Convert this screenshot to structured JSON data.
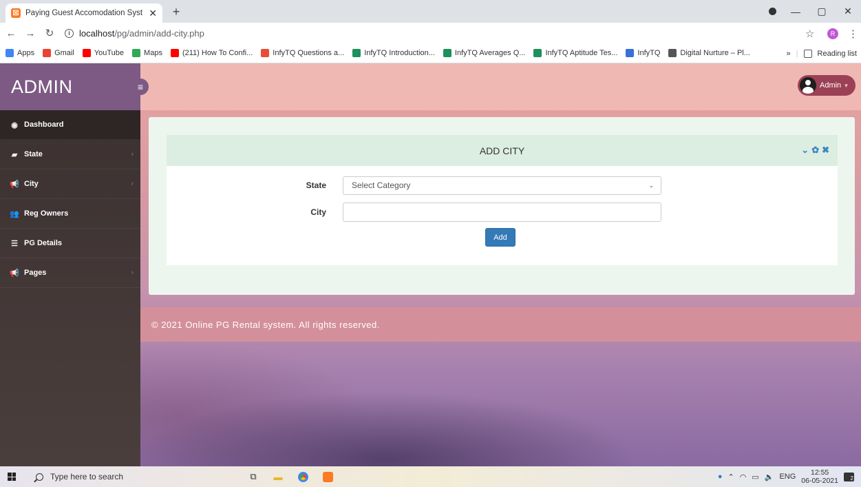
{
  "browser": {
    "tab_title": "Paying Guest Accomodation Syst",
    "url_host": "localhost",
    "url_path": "/pg/admin/add-city.php",
    "profile_initial": "R",
    "bookmarks": [
      {
        "label": "Apps",
        "color": "#4285f4"
      },
      {
        "label": "Gmail",
        "color": "#ea4335"
      },
      {
        "label": "YouTube",
        "color": "#ff0000"
      },
      {
        "label": "Maps",
        "color": "#34a853"
      },
      {
        "label": "(211) How To Confi...",
        "color": "#ff0000"
      },
      {
        "label": "InfyTQ Questions a...",
        "color": "#e94b35"
      },
      {
        "label": "InfyTQ Introduction...",
        "color": "#1f8f5c"
      },
      {
        "label": "InfyTQ Averages Q...",
        "color": "#1f8f5c"
      },
      {
        "label": "InfyTQ Aptitude Tes...",
        "color": "#1f8f5c"
      },
      {
        "label": "InfyTQ",
        "color": "#3a6fd8"
      },
      {
        "label": "Digital Nurture – Pl...",
        "color": "#555555"
      }
    ],
    "more_bookmarks": "»",
    "reading_list": "Reading list"
  },
  "sidebar": {
    "brand": "ADMIN",
    "items": [
      {
        "label": "Dashboard",
        "icon": "dashboard-icon",
        "glyph": "◉",
        "submenu": false
      },
      {
        "label": "State",
        "icon": "state-icon",
        "glyph": "▰",
        "submenu": true
      },
      {
        "label": "City",
        "icon": "megaphone-icon",
        "glyph": "📢",
        "submenu": true
      },
      {
        "label": "Reg Owners",
        "icon": "users-icon",
        "glyph": "👥",
        "submenu": false
      },
      {
        "label": "PG Details",
        "icon": "list-icon",
        "glyph": "☰",
        "submenu": false
      },
      {
        "label": "Pages",
        "icon": "megaphone-icon",
        "glyph": "📢",
        "submenu": true
      }
    ]
  },
  "header": {
    "user_label": "Admin"
  },
  "panel": {
    "title": "ADD CITY",
    "state_label": "State",
    "state_selected": "Select Category",
    "city_label": "City",
    "city_value": "",
    "add_label": "Add"
  },
  "footer": {
    "text": "© 2021 Online PG Rental system. All rights reserved."
  },
  "taskbar": {
    "search_placeholder": "Type here to search",
    "language": "ENG",
    "time": "12:55",
    "date": "06-05-2021",
    "notifications": "2"
  },
  "colors": {
    "brand_purple": "#7c5a83",
    "primary_button": "#337ab7",
    "panel_header": "#dbeee1"
  }
}
